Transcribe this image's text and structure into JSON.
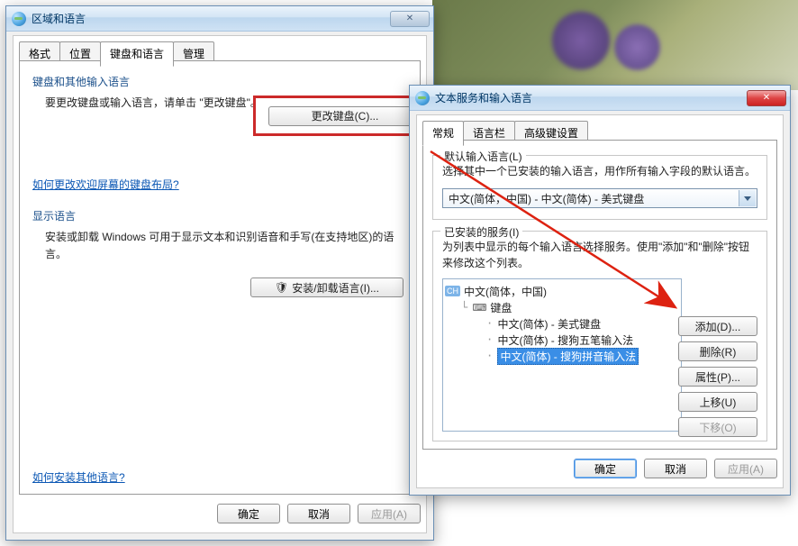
{
  "bg_dialog": {
    "title": "区域和语言",
    "tabs": [
      "格式",
      "位置",
      "键盘和语言",
      "管理"
    ],
    "active_tab": 2,
    "section1_title": "键盘和其他输入语言",
    "section1_text": "要更改键盘或输入语言，请单击 \"更改键盘\"。",
    "change_keyboard_btn": "更改键盘(C)...",
    "help_link1": "如何更改欢迎屏幕的键盘布局?",
    "section2_title": "显示语言",
    "section2_text": "安装或卸载 Windows 可用于显示文本和识别语音和手写(在支持地区)的语言。",
    "install_lang_btn": "安装/卸载语言(I)...",
    "help_link2": "如何安装其他语言?",
    "ok": "确定",
    "cancel": "取消",
    "apply": "应用(A)"
  },
  "fg_dialog": {
    "title": "文本服务和输入语言",
    "tabs": [
      "常规",
      "语言栏",
      "高级键设置"
    ],
    "active_tab": 0,
    "default_legend": "默认输入语言(L)",
    "default_text": "选择其中一个已安装的输入语言，用作所有输入字段的默认语言。",
    "combo_value": "中文(简体，中国) - 中文(简体) - 美式键盘",
    "installed_legend": "已安装的服务(I)",
    "installed_text": "为列表中显示的每个输入语言选择服务。使用\"添加\"和\"删除\"按钮来修改这个列表。",
    "tree_root": "中文(简体，中国)",
    "tree_kb": "键盘",
    "tree_items": [
      "中文(简体) - 美式键盘",
      "中文(简体) - 搜狗五笔输入法",
      "中文(简体) - 搜狗拼音输入法"
    ],
    "btn_add": "添加(D)...",
    "btn_del": "删除(R)",
    "btn_prop": "属性(P)...",
    "btn_up": "上移(U)",
    "btn_down": "下移(O)",
    "ok": "确定",
    "cancel": "取消",
    "apply": "应用(A)"
  }
}
